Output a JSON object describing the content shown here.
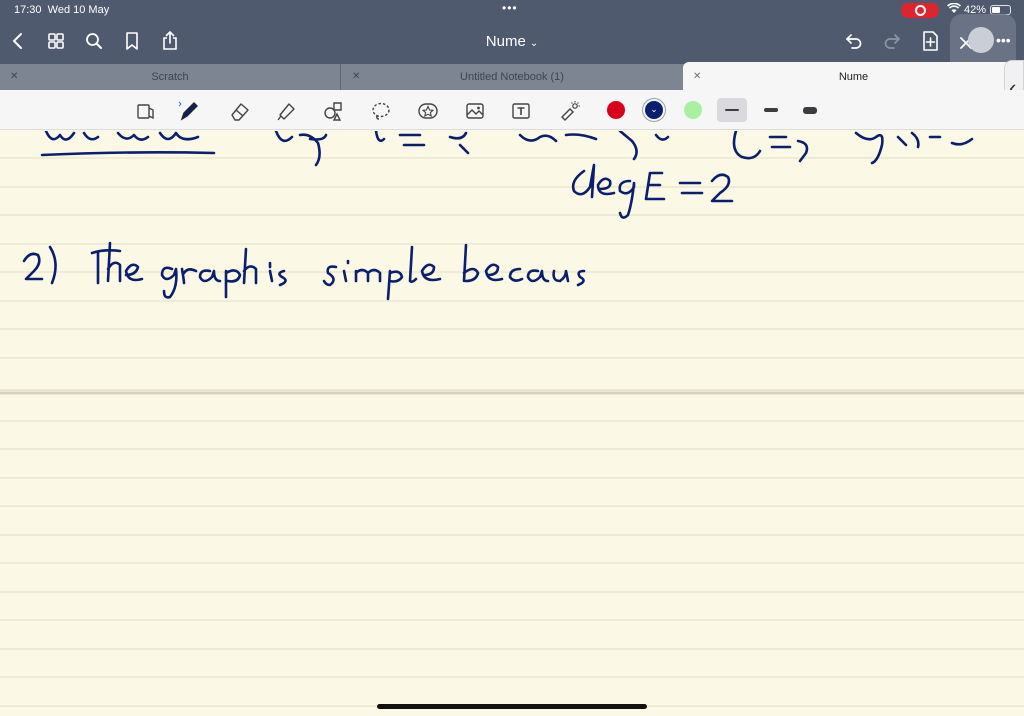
{
  "status": {
    "time": "17:30",
    "date": "Wed 10 May",
    "battery": "42%",
    "recording_color": "#e0242f"
  },
  "nav": {
    "title": "Nume",
    "icons": [
      "back-chevron-icon",
      "grid-icon",
      "search-icon",
      "bookmark-icon",
      "share-icon",
      "undo-icon",
      "redo-icon",
      "add-page-icon",
      "close-icon",
      "more-icon"
    ]
  },
  "tabs": [
    {
      "label": "Scratch",
      "active": false
    },
    {
      "label": "Untitled Notebook (1)",
      "active": false
    },
    {
      "label": "Nume",
      "active": true
    }
  ],
  "toolbar": {
    "tools": [
      "read-mode-icon",
      "pen-icon",
      "eraser-icon",
      "highlighter-icon",
      "shapes-icon",
      "lasso-icon",
      "sticker-icon",
      "image-icon",
      "text-icon",
      "laser-pointer-icon"
    ],
    "colors": [
      "#d9001b",
      "#0a1f6e",
      "#a9f0a2"
    ],
    "selected_color": "#0a1f6e",
    "stroke_widths": [
      "thin",
      "medium",
      "thick"
    ]
  },
  "colors": {
    "nav_bg": "#4f5a6e",
    "tabs_bg": "#7d8593",
    "paper_bg": "#fbf8e6",
    "ink": "#0a1f6e",
    "rule_line": "#e3dfc6"
  }
}
